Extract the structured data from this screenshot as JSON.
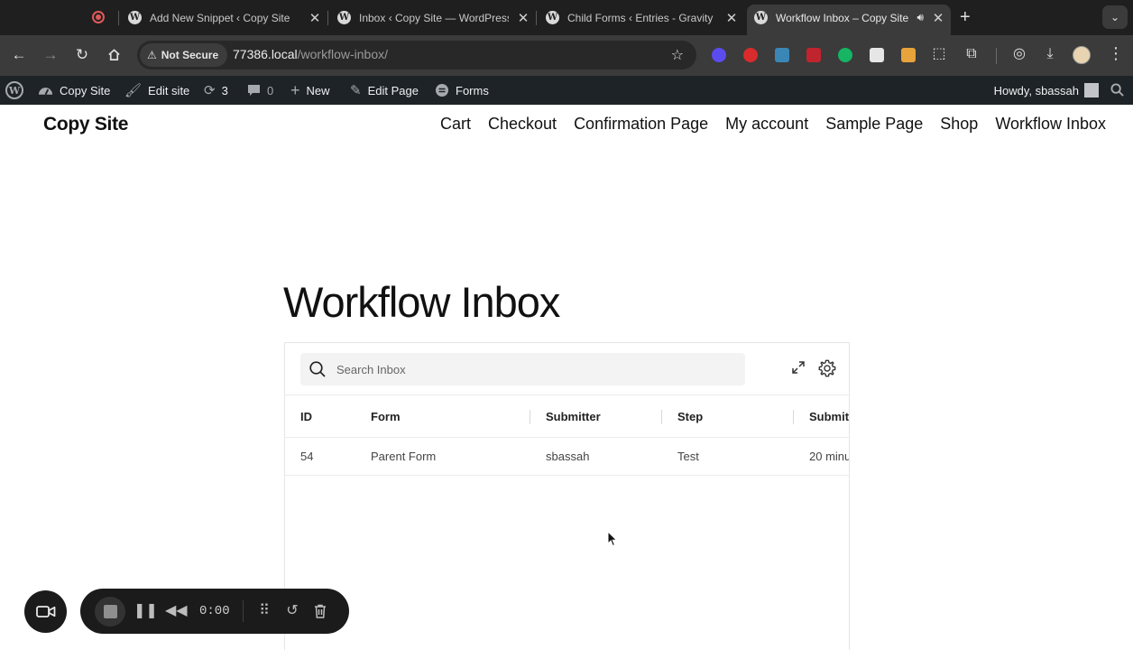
{
  "browser": {
    "tabs": [
      {
        "title": "Add New Snippet ‹ Copy Site"
      },
      {
        "title": "Inbox ‹ Copy Site — WordPress"
      },
      {
        "title": "Child Forms ‹ Entries - Gravity"
      },
      {
        "title": "Workflow Inbox – Copy Site",
        "active": true
      }
    ],
    "security_label": "Not Secure",
    "url_host": "77386.local",
    "url_path": "/workflow-inbox/"
  },
  "admin_bar": {
    "site_name": "Copy Site",
    "edit_site": "Edit site",
    "updates_count": "3",
    "comments_count": "0",
    "new_label": "New",
    "edit_page": "Edit Page",
    "forms": "Forms",
    "howdy": "Howdy, sbassah"
  },
  "site": {
    "title": "Copy Site",
    "nav": [
      "Cart",
      "Checkout",
      "Confirmation Page",
      "My account",
      "Sample Page",
      "Shop",
      "Workflow Inbox"
    ]
  },
  "page": {
    "title": "Workflow Inbox"
  },
  "inbox": {
    "search_placeholder": "Search Inbox",
    "columns": [
      "ID",
      "Form",
      "Submitter",
      "Step",
      "Submit"
    ],
    "rows": [
      {
        "id": "54",
        "form": "Parent Form",
        "submitter": "sbassah",
        "step": "Test",
        "submitted": "20 minu"
      }
    ]
  },
  "recorder": {
    "time": "0:00"
  },
  "colors": {
    "tab_strip": "#1f1f1f",
    "toolbar": "#3b3b3b",
    "wp_admin_bar": "#1d2327",
    "recorder_bg": "#1b1b1b"
  }
}
